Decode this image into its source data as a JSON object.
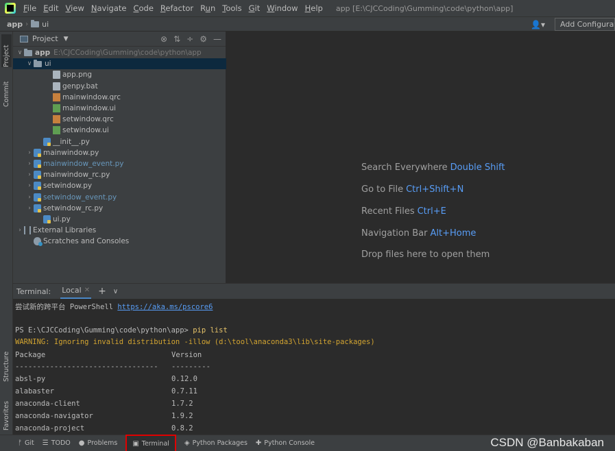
{
  "menubar": {
    "items": [
      {
        "pre": "",
        "ul": "F",
        "post": "ile"
      },
      {
        "pre": "",
        "ul": "E",
        "post": "dit"
      },
      {
        "pre": "",
        "ul": "V",
        "post": "iew"
      },
      {
        "pre": "",
        "ul": "N",
        "post": "avigate"
      },
      {
        "pre": "",
        "ul": "C",
        "post": "ode"
      },
      {
        "pre": "",
        "ul": "R",
        "post": "efactor"
      },
      {
        "pre": "R",
        "ul": "u",
        "post": "n"
      },
      {
        "pre": "",
        "ul": "T",
        "post": "ools"
      },
      {
        "pre": "",
        "ul": "G",
        "post": "it"
      },
      {
        "pre": "",
        "ul": "W",
        "post": "indow"
      },
      {
        "pre": "",
        "ul": "H",
        "post": "elp"
      }
    ],
    "window_title": "app [E:\\CJCCoding\\Gumming\\code\\python\\app]"
  },
  "navbar": {
    "crumbs": [
      "app",
      "ui"
    ],
    "add_config": "Add Configuration..."
  },
  "left_strip": {
    "tabs": [
      "Project",
      "Commit",
      "Structure",
      "Favorites"
    ]
  },
  "project": {
    "title": "Project",
    "tree": [
      {
        "label": "app",
        "extra": "E:\\CJCCoding\\Gumming\\code\\python\\app",
        "icon": "folder",
        "indent": 0,
        "arrow": "v",
        "bold": true
      },
      {
        "label": "ui",
        "icon": "folder",
        "indent": 1,
        "arrow": "v",
        "selected": true
      },
      {
        "label": "app.png",
        "icon": "file",
        "indent": 3
      },
      {
        "label": "genpy.bat",
        "icon": "file",
        "indent": 3
      },
      {
        "label": "mainwindow.qrc",
        "icon": "qrc",
        "indent": 3
      },
      {
        "label": "mainwindow.ui",
        "icon": "ui",
        "indent": 3
      },
      {
        "label": "setwindow.qrc",
        "icon": "qrc",
        "indent": 3
      },
      {
        "label": "setwindow.ui",
        "icon": "ui",
        "indent": 3
      },
      {
        "label": "__init__.py",
        "icon": "py",
        "indent": 2
      },
      {
        "label": "mainwindow.py",
        "icon": "py",
        "indent": 1,
        "arrow": ">"
      },
      {
        "label": "mainwindow_event.py",
        "icon": "py",
        "indent": 1,
        "arrow": ">",
        "blue": true
      },
      {
        "label": "mainwindow_rc.py",
        "icon": "py",
        "indent": 1,
        "arrow": ">"
      },
      {
        "label": "setwindow.py",
        "icon": "py",
        "indent": 1,
        "arrow": ">"
      },
      {
        "label": "setwindow_event.py",
        "icon": "py",
        "indent": 1,
        "arrow": ">",
        "blue": true
      },
      {
        "label": "setwindow_rc.py",
        "icon": "py",
        "indent": 1,
        "arrow": ">"
      },
      {
        "label": "ui.py",
        "icon": "py",
        "indent": 2
      },
      {
        "label": "External Libraries",
        "icon": "lib",
        "indent": 0,
        "arrow": ">"
      },
      {
        "label": "Scratches and Consoles",
        "icon": "scratch",
        "indent": 1
      }
    ]
  },
  "editor": {
    "hints": [
      {
        "text": "Search Everywhere",
        "key": "Double Shift"
      },
      {
        "text": "Go to File",
        "key": "Ctrl+Shift+N"
      },
      {
        "text": "Recent Files",
        "key": "Ctrl+E"
      },
      {
        "text": "Navigation Bar",
        "key": "Alt+Home"
      },
      {
        "text": "Drop files here to open them",
        "key": ""
      }
    ]
  },
  "terminal": {
    "title": "Terminal:",
    "tab": "Local",
    "lines": {
      "try_text": "尝试新的跨平台 PowerShell ",
      "try_link": "https://aka.ms/pscore6",
      "prompt": "PS E:\\CJCCoding\\Gumming\\code\\python\\app> ",
      "command": "pip list",
      "warning": "WARNING: Ignoring invalid distribution -illow (d:\\tool\\anaconda3\\lib\\site-packages)",
      "header_pkg": "Package",
      "header_ver": "Version",
      "sep_pkg": "---------------------------------",
      "sep_ver": "---------"
    },
    "packages": [
      {
        "name": "absl-py",
        "version": "0.12.0"
      },
      {
        "name": "alabaster",
        "version": "0.7.11"
      },
      {
        "name": "anaconda-client",
        "version": "1.7.2"
      },
      {
        "name": "anaconda-navigator",
        "version": "1.9.2"
      },
      {
        "name": "anaconda-project",
        "version": "0.8.2"
      }
    ]
  },
  "bottombar": {
    "items": [
      {
        "label": "Git",
        "icon": "git-icon",
        "glyph": "ᚠ"
      },
      {
        "label": "TODO",
        "icon": "todo-icon",
        "glyph": "☰"
      },
      {
        "label": "Problems",
        "icon": "problems-icon",
        "glyph": "●"
      },
      {
        "label": "Terminal",
        "icon": "terminal-icon",
        "glyph": "▣",
        "active": true
      },
      {
        "label": "Python Packages",
        "icon": "packages-icon",
        "glyph": "◈"
      },
      {
        "label": "Python Console",
        "icon": "python-console-icon",
        "glyph": "✚"
      }
    ],
    "watermark": "CSDN @Banbakaban"
  }
}
